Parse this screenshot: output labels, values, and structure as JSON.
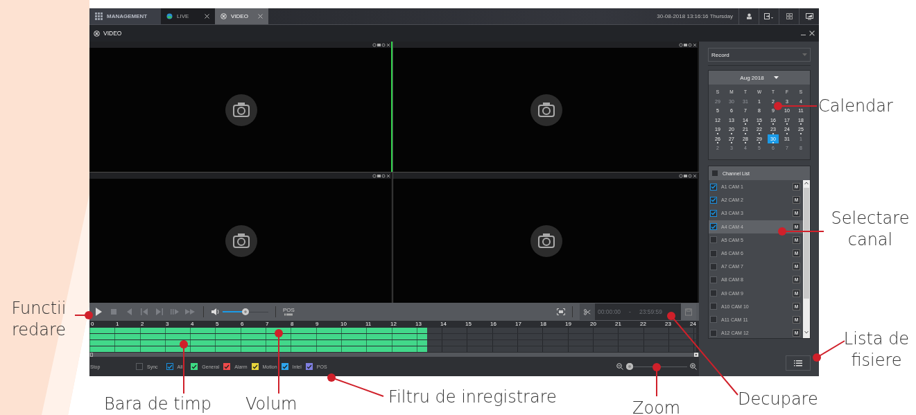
{
  "tabs": [
    {
      "label": "MANAGEMENT",
      "kind": "home",
      "selected": false
    },
    {
      "label": "LIVE",
      "kind": "live",
      "selected": false
    },
    {
      "label": "VIDEO",
      "kind": "video",
      "selected": true
    }
  ],
  "datetime": "30-08-2018 13:16:16 Thursday",
  "panel_title": "VIDEO",
  "video_cells": [
    {
      "selected": true
    },
    {
      "selected": false
    },
    {
      "selected": false
    },
    {
      "selected": false
    }
  ],
  "playback_buttons": [
    {
      "kind": "play",
      "disabled": false
    },
    {
      "kind": "stop",
      "disabled": true
    },
    {
      "kind": "reverse",
      "disabled": true
    },
    {
      "kind": "prev",
      "disabled": true
    },
    {
      "kind": "next",
      "disabled": true
    },
    {
      "kind": "slow",
      "disabled": true
    },
    {
      "kind": "fast",
      "disabled": true
    }
  ],
  "volume": {
    "level": 0.5
  },
  "pos_label": "POS",
  "clip": {
    "start": "00:00:00",
    "separator": "-",
    "end": "23:59:59"
  },
  "timeline": {
    "hours": [
      "0",
      "1",
      "2",
      "3",
      "4",
      "5",
      "6",
      "7",
      "8",
      "9",
      "10",
      "11",
      "12",
      "13",
      "14",
      "15",
      "16",
      "17",
      "18",
      "19",
      "20",
      "21",
      "22",
      "23",
      "24"
    ],
    "rows": [
      {
        "level": 0.557
      },
      {
        "level": 0.557
      },
      {
        "level": 0.557
      },
      {
        "level": 0.557
      }
    ]
  },
  "status": "Stop",
  "filters": [
    {
      "label": "Sync",
      "checked": false
    },
    {
      "label": "All",
      "checked": true
    },
    {
      "label": "General",
      "checked": true,
      "color": "#3ddc84"
    },
    {
      "label": "Alarm",
      "checked": true,
      "color": "#f04a4a"
    },
    {
      "label": "Motion",
      "checked": true,
      "color": "#e6d43c"
    },
    {
      "label": "Intel",
      "checked": true,
      "color": "#2ea6ee"
    },
    {
      "label": "POS",
      "checked": true,
      "color": "#7f7fe0"
    }
  ],
  "zoom": {
    "level": 0.0
  },
  "record_type": "Record",
  "calendar": {
    "month": "Aug 2018",
    "weekdays": [
      "S",
      "M",
      "T",
      "W",
      "T",
      "F",
      "S"
    ],
    "days": [
      {
        "label": "29",
        "kind": "other",
        "marked": false,
        "selected": false
      },
      {
        "label": "30",
        "kind": "other",
        "marked": false,
        "selected": false
      },
      {
        "label": "31",
        "kind": "other",
        "marked": false,
        "selected": false
      },
      {
        "label": "1",
        "kind": "day",
        "marked": false,
        "selected": false
      },
      {
        "label": "2",
        "kind": "day",
        "marked": false,
        "selected": false
      },
      {
        "label": "3",
        "kind": "day",
        "marked": false,
        "selected": false
      },
      {
        "label": "4",
        "kind": "day",
        "marked": false,
        "selected": false
      },
      {
        "label": "5",
        "kind": "day",
        "marked": false,
        "selected": false
      },
      {
        "label": "6",
        "kind": "day",
        "marked": false,
        "selected": false
      },
      {
        "label": "7",
        "kind": "day",
        "marked": false,
        "selected": false
      },
      {
        "label": "8",
        "kind": "day",
        "marked": false,
        "selected": false
      },
      {
        "label": "9",
        "kind": "day",
        "marked": false,
        "selected": false
      },
      {
        "label": "10",
        "kind": "day",
        "marked": false,
        "selected": false
      },
      {
        "label": "11",
        "kind": "day",
        "marked": false,
        "selected": false
      },
      {
        "label": "12",
        "kind": "day",
        "marked": false,
        "selected": false
      },
      {
        "label": "13",
        "kind": "day",
        "marked": false,
        "selected": false
      },
      {
        "label": "14",
        "kind": "day",
        "marked": true,
        "selected": false
      },
      {
        "label": "15",
        "kind": "day",
        "marked": true,
        "selected": false
      },
      {
        "label": "16",
        "kind": "day",
        "marked": true,
        "selected": false
      },
      {
        "label": "17",
        "kind": "day",
        "marked": true,
        "selected": false
      },
      {
        "label": "18",
        "kind": "day",
        "marked": true,
        "selected": false
      },
      {
        "label": "19",
        "kind": "day",
        "marked": true,
        "selected": false
      },
      {
        "label": "20",
        "kind": "day",
        "marked": true,
        "selected": false
      },
      {
        "label": "21",
        "kind": "day",
        "marked": true,
        "selected": false
      },
      {
        "label": "22",
        "kind": "day",
        "marked": true,
        "selected": false
      },
      {
        "label": "23",
        "kind": "day",
        "marked": true,
        "selected": false
      },
      {
        "label": "24",
        "kind": "day",
        "marked": true,
        "selected": false
      },
      {
        "label": "25",
        "kind": "day",
        "marked": true,
        "selected": false
      },
      {
        "label": "26",
        "kind": "day",
        "marked": true,
        "selected": false
      },
      {
        "label": "27",
        "kind": "day",
        "marked": true,
        "selected": false
      },
      {
        "label": "28",
        "kind": "day",
        "marked": true,
        "selected": false
      },
      {
        "label": "29",
        "kind": "day",
        "marked": true,
        "selected": false
      },
      {
        "label": "30",
        "kind": "day",
        "marked": true,
        "selected": true
      },
      {
        "label": "31",
        "kind": "day",
        "marked": false,
        "selected": false
      },
      {
        "label": "1",
        "kind": "other",
        "marked": false,
        "selected": false
      },
      {
        "label": "2",
        "kind": "other",
        "marked": false,
        "selected": false
      },
      {
        "label": "3",
        "kind": "other",
        "marked": false,
        "selected": false
      },
      {
        "label": "4",
        "kind": "other",
        "marked": false,
        "selected": false
      },
      {
        "label": "5",
        "kind": "other",
        "marked": false,
        "selected": false
      },
      {
        "label": "6",
        "kind": "other",
        "marked": false,
        "selected": false
      },
      {
        "label": "7",
        "kind": "other",
        "marked": false,
        "selected": false
      },
      {
        "label": "8",
        "kind": "other",
        "marked": false,
        "selected": false
      }
    ]
  },
  "channel_list": {
    "label": "Channel List",
    "checked": false
  },
  "channels": [
    {
      "name": "A1 CAM 1",
      "checked": true,
      "selected": false,
      "button": "M"
    },
    {
      "name": "A2 CAM 2",
      "checked": true,
      "selected": false,
      "button": "M"
    },
    {
      "name": "A3 CAM 3",
      "checked": true,
      "selected": false,
      "button": "M"
    },
    {
      "name": "A4 CAM 4",
      "checked": true,
      "selected": true,
      "button": "M"
    },
    {
      "name": "A5 CAM 5",
      "checked": false,
      "selected": false,
      "button": "M"
    },
    {
      "name": "A6 CAM 6",
      "checked": false,
      "selected": false,
      "button": "M"
    },
    {
      "name": "A7 CAM 7",
      "checked": false,
      "selected": false,
      "button": "M"
    },
    {
      "name": "A8 CAM 8",
      "checked": false,
      "selected": false,
      "button": "M"
    },
    {
      "name": "A9 CAM 9",
      "checked": false,
      "selected": false,
      "button": "M"
    },
    {
      "name": "A10 CAM 10",
      "checked": false,
      "selected": false,
      "button": "M"
    },
    {
      "name": "A11 CAM 11",
      "checked": false,
      "selected": false,
      "button": "M"
    },
    {
      "name": "A12 CAM 12",
      "checked": false,
      "selected": false,
      "button": "M"
    }
  ],
  "annotations": [
    {
      "text": "Calendar"
    },
    {
      "text": "Selectare canal"
    },
    {
      "text": "Lista de fisiere"
    },
    {
      "text": "Functii redare"
    },
    {
      "text": "Bara de timp"
    },
    {
      "text": "Volum"
    },
    {
      "text": "Filtru de inregistrare"
    },
    {
      "text": "Zoom"
    },
    {
      "text": "Decupare"
    }
  ]
}
